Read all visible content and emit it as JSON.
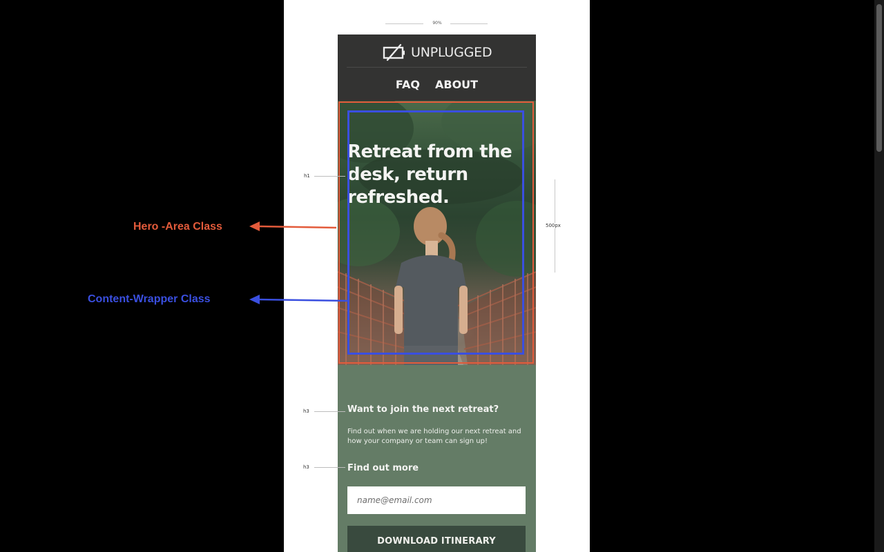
{
  "measure": {
    "width_label": "90%",
    "height_label": "500px"
  },
  "brand": {
    "logo_text": "UNPLUGGED",
    "logo_icon": "unplugged-battery-icon"
  },
  "nav": {
    "items": [
      {
        "label": "FAQ"
      },
      {
        "label": "ABOUT"
      }
    ]
  },
  "hero": {
    "title": "Retreat from the desk, return refreshed."
  },
  "signup": {
    "heading_join": "Want to join the next retreat?",
    "body": "Find out when we are holding our next retreat and how your company or team can sign up!",
    "heading_more": "Find out more",
    "email_placeholder": "name@email.com",
    "button_label": "DOWNLOAD ITINERARY"
  },
  "annotations": {
    "hero_area": "Hero -Area Class",
    "content_wrapper": "Content-Wrapper Class",
    "tag_h1": "h1",
    "tag_h3_join": "h3",
    "tag_h3_more": "h3"
  },
  "colors": {
    "hero_area_accent": "#e35b3b",
    "content_wrapper_accent": "#3a4fe0",
    "header_bg": "#333332",
    "signup_bg": "#647c66",
    "button_bg": "#394a3e"
  }
}
